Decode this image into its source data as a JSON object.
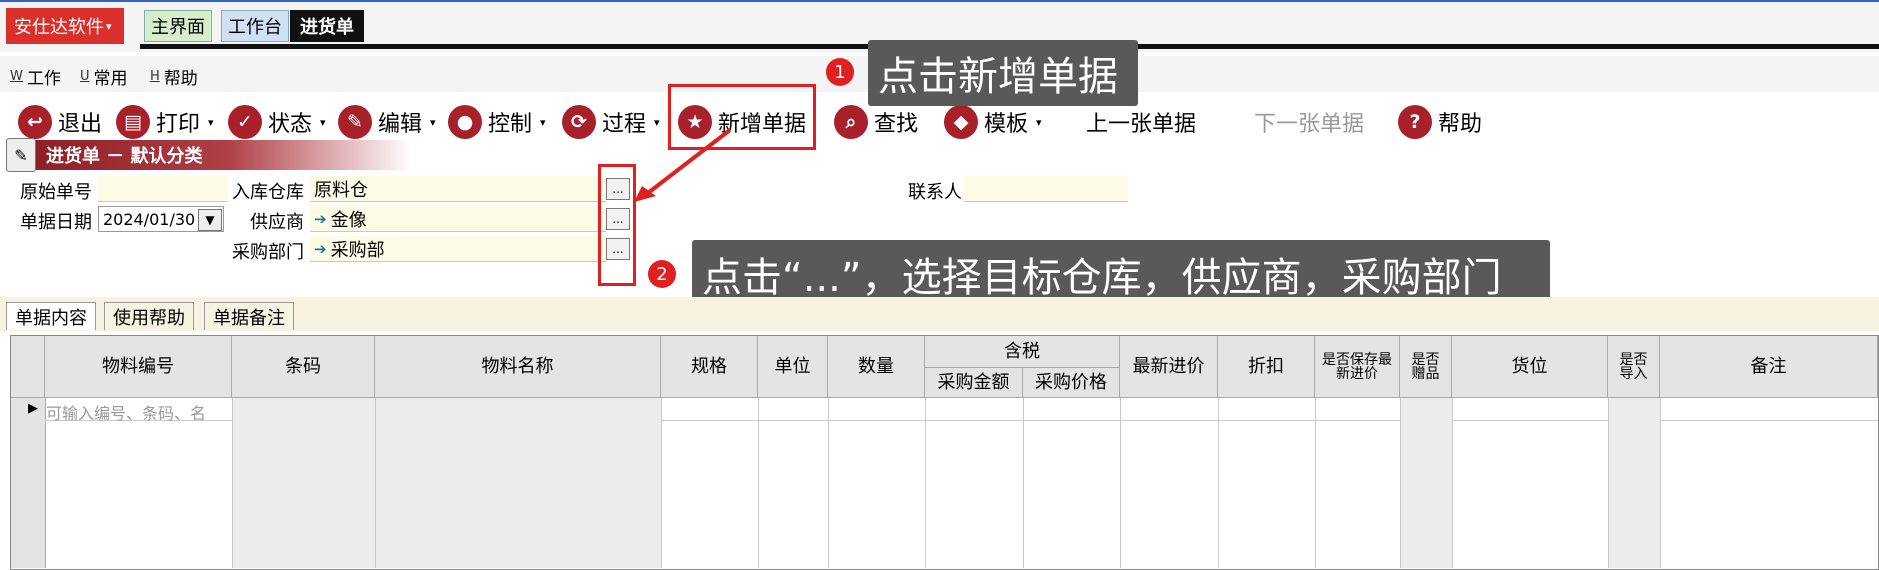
{
  "app": {
    "brand": "安仕达软件",
    "tabs": [
      "主界面",
      "工作台",
      "进货单"
    ]
  },
  "menu": [
    {
      "key": "W",
      "label": "工作"
    },
    {
      "key": "U",
      "label": "常用"
    },
    {
      "key": "H",
      "label": "帮助"
    }
  ],
  "toolbar": {
    "exit": "退出",
    "print": "打印",
    "status": "状态",
    "edit": "编辑",
    "control": "控制",
    "process": "过程",
    "new_doc": "新增单据",
    "find": "查找",
    "template": "模板",
    "prev": "上一张单据",
    "next": "下一张单据",
    "help": "帮助"
  },
  "doc_title": "进货单 － 默认分类",
  "form": {
    "orig_no_label": "原始单号",
    "orig_no": "",
    "date_label": "单据日期",
    "date": "2024/01/30",
    "warehouse_label": "入库仓库",
    "warehouse": "原料仓",
    "supplier_label": "供应商",
    "supplier": "金像",
    "dept_label": "采购部门",
    "dept": "采购部",
    "contact_label": "联系人",
    "contact": "",
    "ellipsis": "..."
  },
  "annotations": {
    "badge1": "1",
    "callout1": "点击新增单据",
    "badge2": "2",
    "callout2": "点击“...”，选择目标仓库，供应商，采购部门"
  },
  "pane_tabs": [
    "单据内容",
    "使用帮助",
    "单据备注"
  ],
  "grid": {
    "headers": {
      "code": "物料编号",
      "barcode": "条码",
      "name": "物料名称",
      "spec": "规格",
      "unit": "单位",
      "qty": "数量",
      "tax_group": "含税",
      "amount": "采购金额",
      "price": "采购价格",
      "last_price": "最新进价",
      "discount": "折扣",
      "save_last": "是否保存最新进价",
      "gift": "是否赠品",
      "location": "货位",
      "import": "是否导入",
      "remark": "备注"
    },
    "row_placeholder": "可输入编号、条码、名"
  }
}
